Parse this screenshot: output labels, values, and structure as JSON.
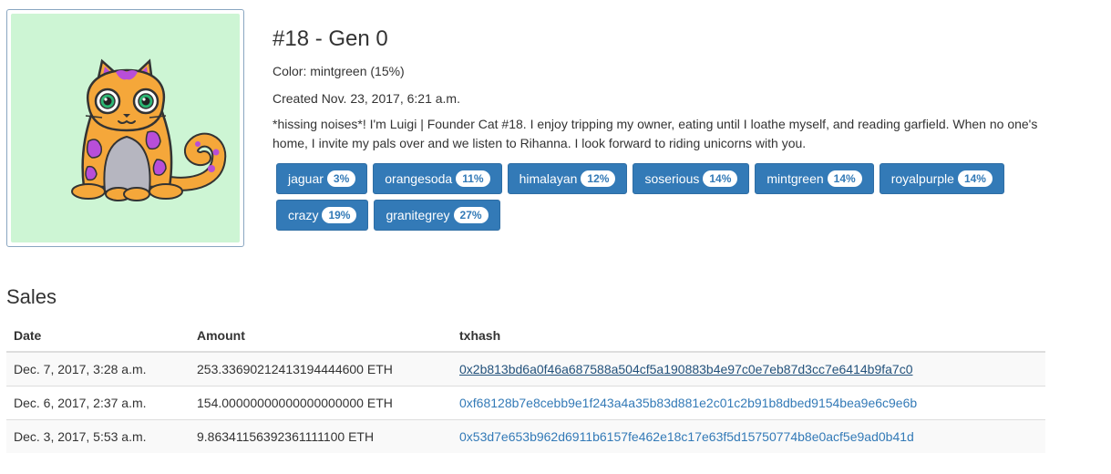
{
  "kitty": {
    "title": "#18 - Gen 0",
    "color": "Color: mintgreen (15%)",
    "created": "Created Nov. 23, 2017, 6:21 a.m.",
    "bio": "*hissing noises*! I'm Luigi | Founder Cat #18. I enjoy tripping my owner, eating until I loathe myself, and reading garfield. When no one's home, I invite my pals over and we listen to Rihanna. I look forward to riding unicorns with you.",
    "background_color": "#cdf5d4"
  },
  "traits": [
    {
      "name": "jaguar",
      "pct": "3%"
    },
    {
      "name": "orangesoda",
      "pct": "11%"
    },
    {
      "name": "himalayan",
      "pct": "12%"
    },
    {
      "name": "soserious",
      "pct": "14%"
    },
    {
      "name": "mintgreen",
      "pct": "14%"
    },
    {
      "name": "royalpurple",
      "pct": "14%"
    },
    {
      "name": "crazy",
      "pct": "19%"
    },
    {
      "name": "granitegrey",
      "pct": "27%"
    }
  ],
  "sales": {
    "title": "Sales",
    "headers": {
      "date": "Date",
      "amount": "Amount",
      "txhash": "txhash"
    },
    "rows": [
      {
        "date": "Dec. 7, 2017, 3:28 a.m.",
        "amount": "253.33690212413194444600 ETH",
        "txhash": "0x2b813bd6a0f46a687588a504cf5a190883b4e97c0e7eb87d3cc7e6414b9fa7c0"
      },
      {
        "date": "Dec. 6, 2017, 2:37 a.m.",
        "amount": "154.00000000000000000000 ETH",
        "txhash": "0xf68128b7e8cebb9e1f243a4a35b83d881e2c01c2b91b8dbed9154bea9e6c9e6b"
      },
      {
        "date": "Dec. 3, 2017, 5:53 a.m.",
        "amount": "9.86341156392361111100 ETH",
        "txhash": "0x53d7e653b962d6911b6157fe462e18c17e63f5d15750774b8e0acf5e9ad0b41d"
      }
    ]
  },
  "colors": {
    "accent": "#337ab7",
    "body_orange": "#f5a73a",
    "spots": "#b84ed8",
    "belly": "#b6b6c0"
  }
}
